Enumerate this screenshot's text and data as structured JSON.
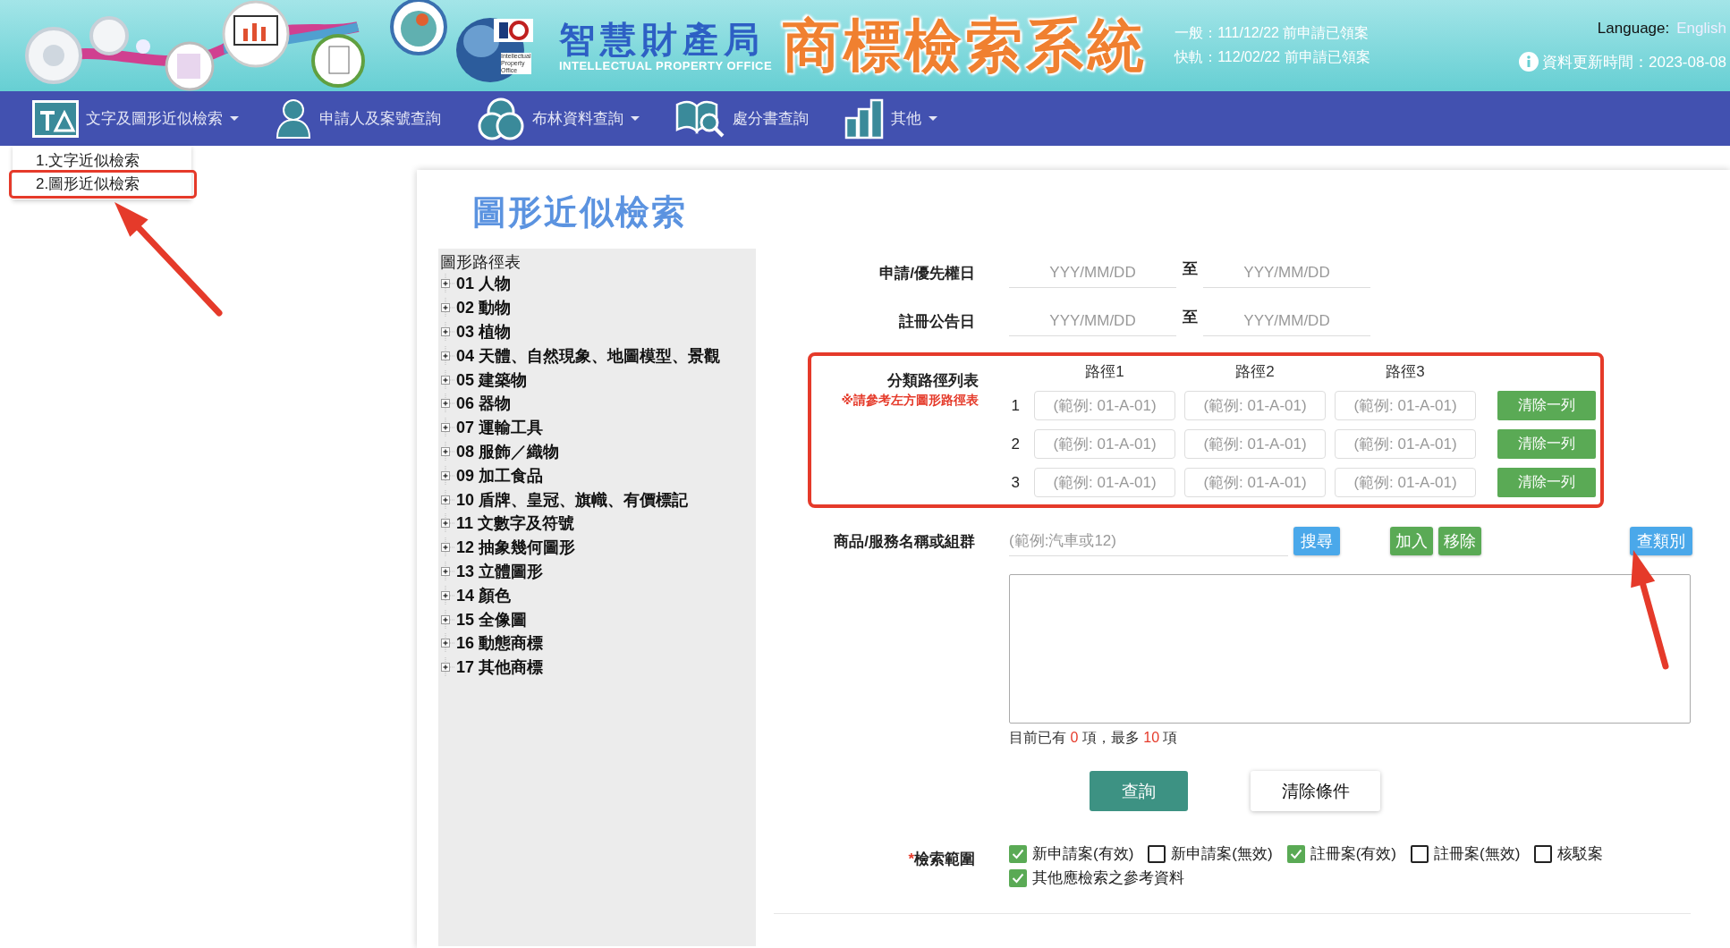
{
  "header": {
    "logo_caption": "Intellectual Property Office",
    "org_name": "智慧財產局",
    "org_name_en": "INTELLECTUAL PROPERTY OFFICE",
    "system_title": "商標檢索系統",
    "notices": [
      "一般：111/12/22 前申請已領案",
      "快軌：112/02/22 前申請已領案"
    ],
    "language_label": "Language:",
    "language_link": "English",
    "update_time": "資料更新時間：2023-08-08"
  },
  "nav": [
    {
      "label": "文字及圖形近似檢索",
      "kind": "ta",
      "dropdown": true
    },
    {
      "label": "申請人及案號查詢",
      "kind": "person",
      "dropdown": false
    },
    {
      "label": "布林資料查詢",
      "kind": "circles",
      "dropdown": true
    },
    {
      "label": "處分書查詢",
      "kind": "book",
      "dropdown": false
    },
    {
      "label": "其他",
      "kind": "chart",
      "dropdown": true
    }
  ],
  "dropdown_menu": [
    {
      "label": "1.文字近似檢索",
      "annotated": false
    },
    {
      "label": "2.圖形近似檢索",
      "annotated": true
    }
  ],
  "page_title": "圖形近似檢索",
  "tree": {
    "title": "圖形路徑表",
    "items": [
      {
        "label": "01 人物",
        "expanded": false
      },
      {
        "label": "02 動物",
        "expanded": false
      },
      {
        "label": "03 植物",
        "expanded": false
      },
      {
        "label": "04 天體、自然現象、地圖模型、景觀",
        "expanded": false
      },
      {
        "label": "05 建築物",
        "expanded": false
      },
      {
        "label": "06 器物",
        "expanded": false
      },
      {
        "label": "07 運輸工具",
        "expanded": false
      },
      {
        "label": "08 服飾／織物",
        "expanded": false
      },
      {
        "label": "09 加工食品",
        "expanded": false
      },
      {
        "label": "10 盾牌、皇冠、旗幟、有價標記",
        "expanded": false
      },
      {
        "label": "11 文數字及符號",
        "expanded": false
      },
      {
        "label": "12 抽象幾何圖形",
        "expanded": false
      },
      {
        "label": "13 立體圖形",
        "expanded": false
      },
      {
        "label": "14 顏色",
        "expanded": false
      },
      {
        "label": "15 全像圖",
        "expanded": false
      },
      {
        "label": "16 動態商標",
        "expanded": false
      },
      {
        "label": "17 其他商標",
        "expanded": false
      }
    ]
  },
  "date_rows": [
    {
      "label": "申請/優先權日",
      "from_placeholder": "YYY/MM/DD",
      "separator": "至",
      "to_placeholder": "YYY/MM/DD"
    },
    {
      "label": "註冊公告日",
      "from_placeholder": "YYY/MM/DD",
      "separator": "至",
      "to_placeholder": "YYY/MM/DD"
    }
  ],
  "path_table": {
    "label": "分類路徑列表",
    "note": "※請參考左方圖形路徑表",
    "columns": [
      "路徑1",
      "路徑2",
      "路徑3"
    ],
    "rows": [
      {
        "number": "1",
        "placeholders": [
          "(範例: 01-A-01)",
          "(範例: 01-A-01)",
          "(範例: 01-A-01)"
        ],
        "button": "清除一列"
      },
      {
        "number": "2",
        "placeholders": [
          "(範例: 01-A-01)",
          "(範例: 01-A-01)",
          "(範例: 01-A-01)"
        ],
        "button": "清除一列"
      },
      {
        "number": "3",
        "placeholders": [
          "(範例: 01-A-01)",
          "(範例: 01-A-01)",
          "(範例: 01-A-01)"
        ],
        "button": "清除一列"
      }
    ]
  },
  "goods": {
    "label": "商品/服務名稱或組群",
    "placeholder": "(範例:汽車或12)",
    "search_button": "搜尋",
    "add_button": "加入",
    "remove_button": "移除",
    "category_button": "查類別"
  },
  "count": {
    "prefix": "目前已有",
    "count": "0",
    "middle": "項，最多",
    "max": "10",
    "suffix": "項"
  },
  "actions": {
    "query": "查詢",
    "clear": "清除條件"
  },
  "scope": {
    "required_mark": "*",
    "label": "檢索範圍",
    "options": [
      {
        "label": "新申請案(有效)",
        "checked": true
      },
      {
        "label": "新申請案(無效)",
        "checked": false
      },
      {
        "label": "註冊案(有效)",
        "checked": true
      },
      {
        "label": "註冊案(無效)",
        "checked": false
      },
      {
        "label": "核駁案",
        "checked": false
      },
      {
        "label": "其他應檢索之參考資料",
        "checked": true
      }
    ]
  }
}
